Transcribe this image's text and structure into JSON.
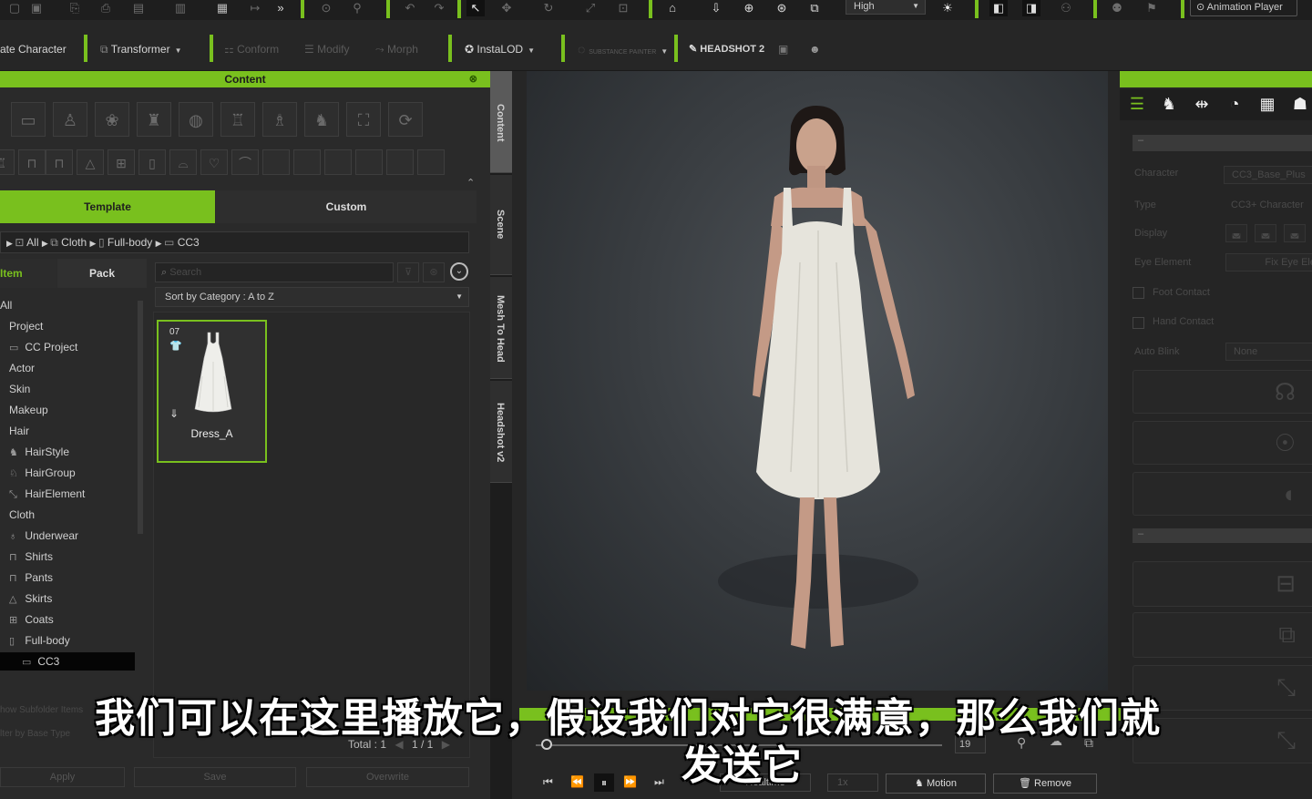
{
  "toolbar": {
    "quality": "High",
    "animation_player": "Animation Player",
    "create_character": "ate Character",
    "transformer": "Transformer",
    "conform": "Conform",
    "modify": "Modify",
    "morph": "Morph",
    "instalod": "InstaLOD",
    "substance": "SUBSTANCE PAINTER",
    "headshot2": "HEADSHOT 2"
  },
  "content_panel": {
    "title": "Content",
    "tabs": {
      "template": "Template",
      "custom": "Custom"
    },
    "breadcrumb": [
      "All",
      "Cloth",
      "Full-body",
      "CC3"
    ],
    "subtabs": {
      "item": "Item",
      "pack": "Pack"
    },
    "search_placeholder": "Search",
    "sort": "Sort by Category : A to Z",
    "tree": [
      "All",
      "Project",
      "CC Project",
      "Actor",
      "Skin",
      "Makeup",
      "Hair",
      "HairStyle",
      "HairGroup",
      "HairElement",
      "Cloth",
      "Underwear",
      "Shirts",
      "Pants",
      "Skirts",
      "Coats",
      "Full-body",
      "CC3"
    ],
    "show_subfolder": "how Subfolder Items",
    "filter_base": "lter by Base Type",
    "item_card": {
      "number": "07",
      "name": "Dress_A"
    },
    "total_label": "Total : 1",
    "page": "1",
    "page_sep": "/",
    "page_total": "1",
    "buttons": {
      "apply": "Apply",
      "save": "Save",
      "overwrite": "Overwrite"
    }
  },
  "side_tabs": [
    "Content",
    "Scene",
    "Mesh To Head",
    "Headshot v2"
  ],
  "right_panel": {
    "character_label": "Character",
    "character_value": "CC3_Base_Plus",
    "type_label": "Type",
    "type_value": "CC3+ Character",
    "display_label": "Display",
    "eye_element_label": "Eye Element",
    "eye_element_value": "Fix Eye Ele",
    "foot_contact": "Foot Contact",
    "hand_contact": "Hand Contact",
    "auto_blink_label": "Auto Blink",
    "auto_blink_value": "None"
  },
  "timeline": {
    "frame": "19",
    "realtime": "Realtime",
    "speed": "1x",
    "motion": "Motion",
    "remove": "Remove"
  },
  "subtitles": {
    "line1": "我们可以在这里播放它，假设我们对它很满意，那么我们就",
    "line2": "发送它"
  },
  "colors": {
    "accent": "#79c01e",
    "panel_bg": "#2a2a2a"
  }
}
